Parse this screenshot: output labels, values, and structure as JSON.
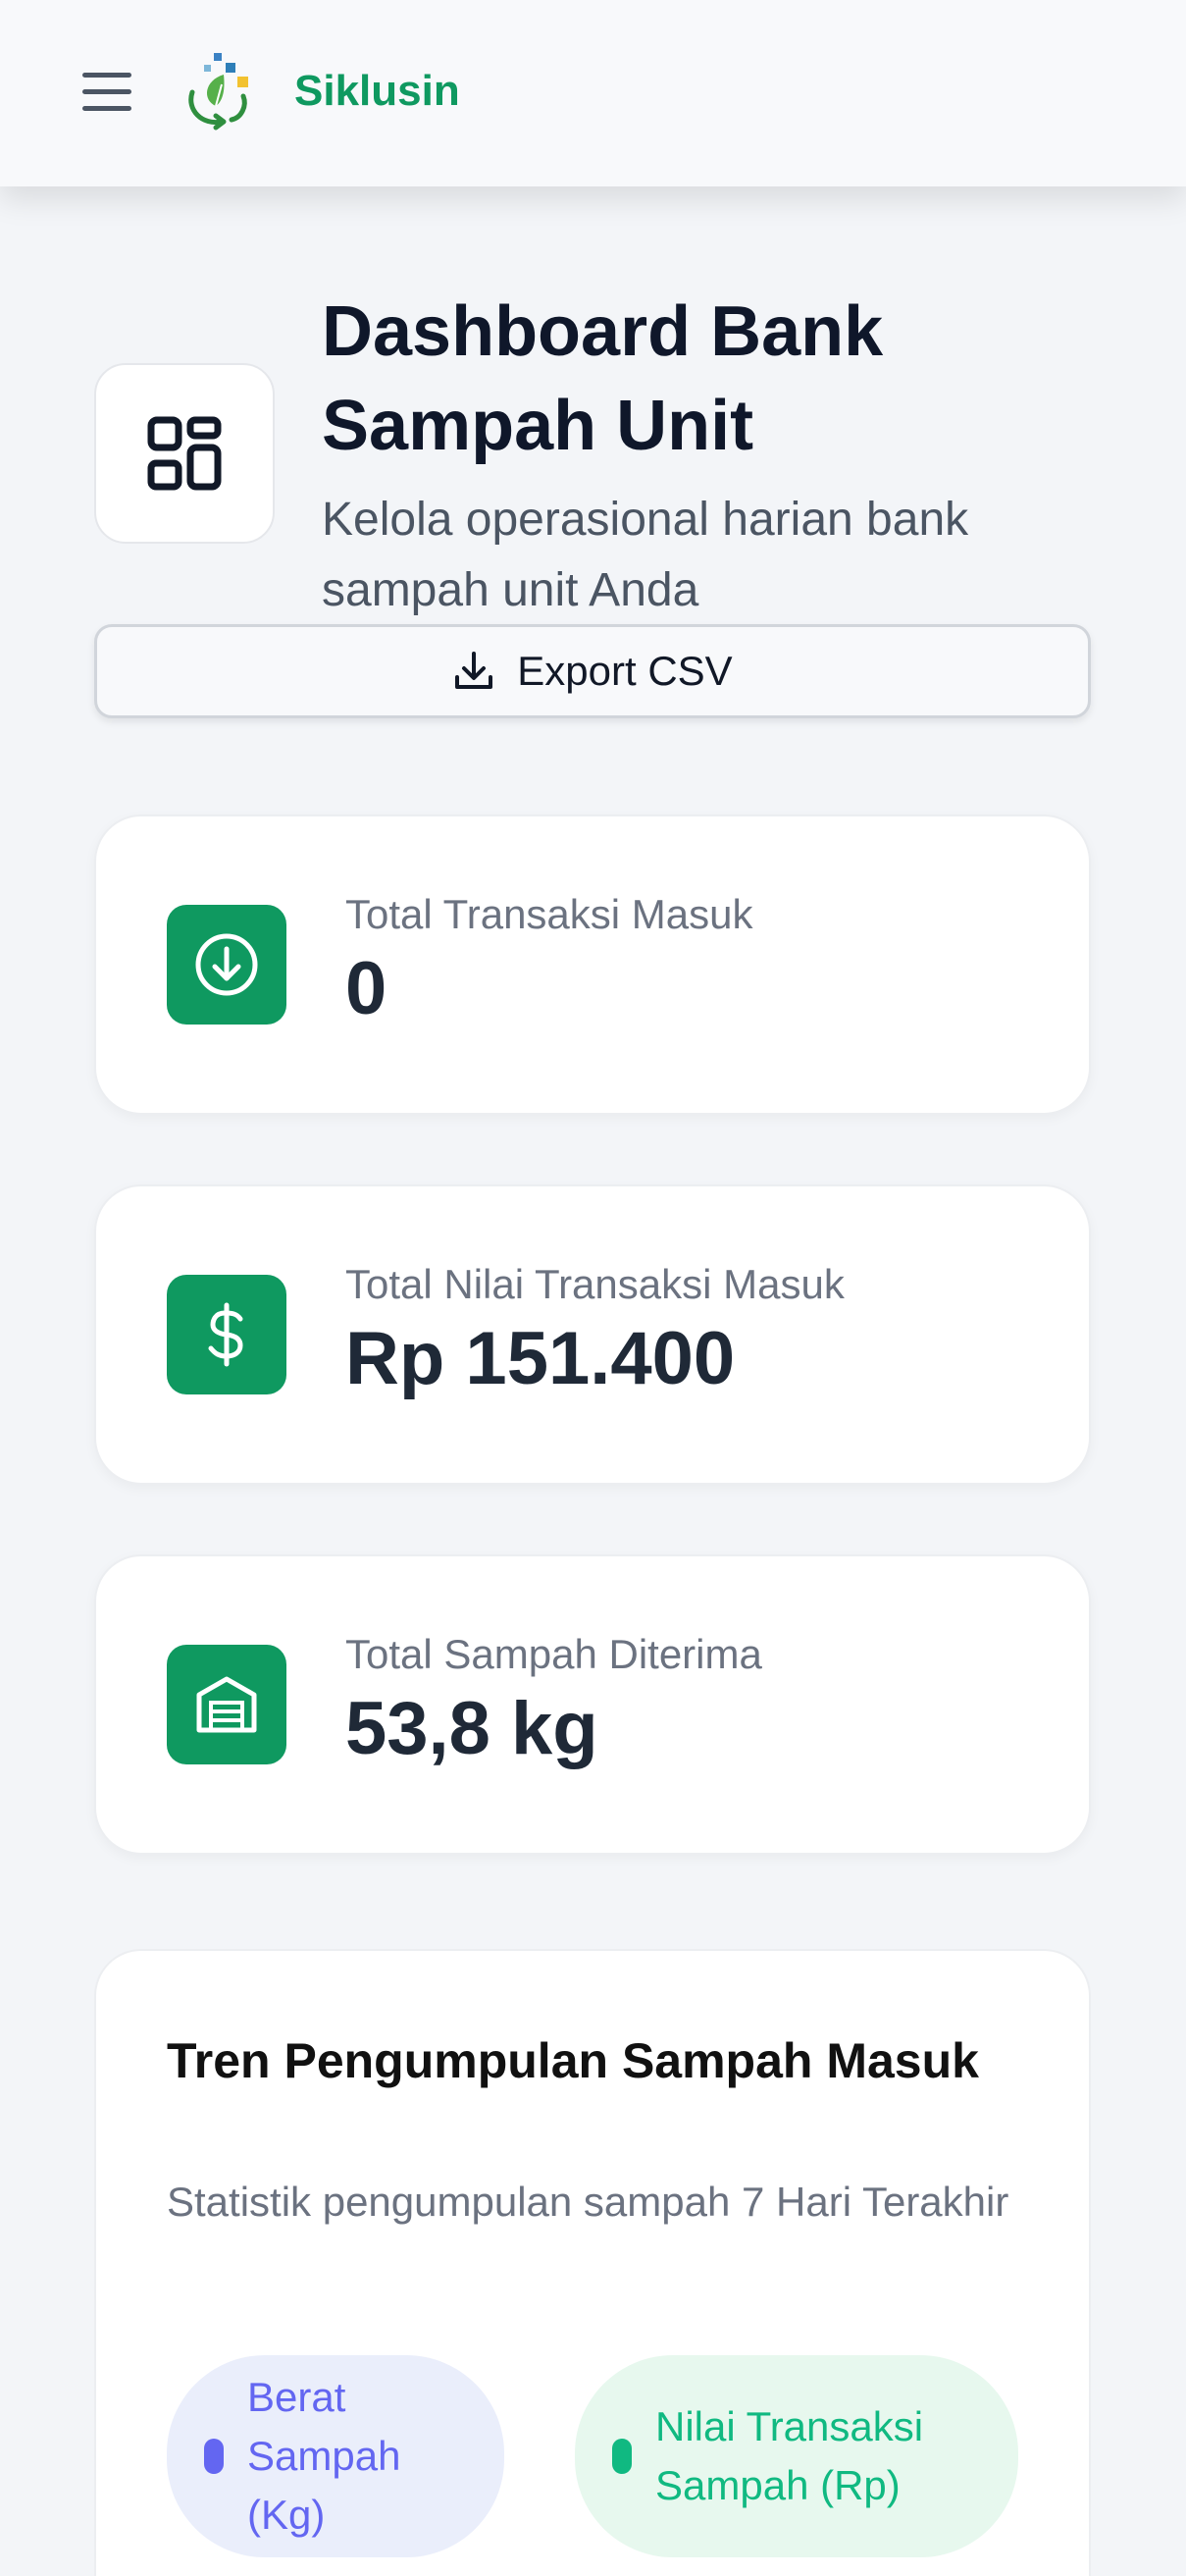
{
  "app": {
    "brand": "Siklusin"
  },
  "header": {
    "title": "Dashboard Bank Sampah Unit",
    "subtitle": "Kelola operasional harian bank sampah unit Anda",
    "export_label": "Export CSV"
  },
  "stats": [
    {
      "label": "Total Transaksi Masuk",
      "value": "0",
      "icon": "arrow-down-circle-icon"
    },
    {
      "label": "Total Nilai Transaksi Masuk",
      "value": "Rp 151.400",
      "icon": "dollar-icon"
    },
    {
      "label": "Total Sampah Diterima",
      "value": "53,8 kg",
      "icon": "warehouse-icon"
    }
  ],
  "chart": {
    "title": "Tren Pengumpulan Sampah Masuk",
    "subtitle": "Statistik pengumpulan sampah 7 Hari Terakhir",
    "legend": [
      {
        "label": "Berat Sampah (Kg)",
        "color": "#6366f1"
      },
      {
        "label": "Nilai Transaksi Sampah (Rp)",
        "color": "#10b981"
      }
    ]
  },
  "colors": {
    "accent": "#0f9960",
    "text_dark": "#0f172a",
    "muted": "#6b7280"
  }
}
